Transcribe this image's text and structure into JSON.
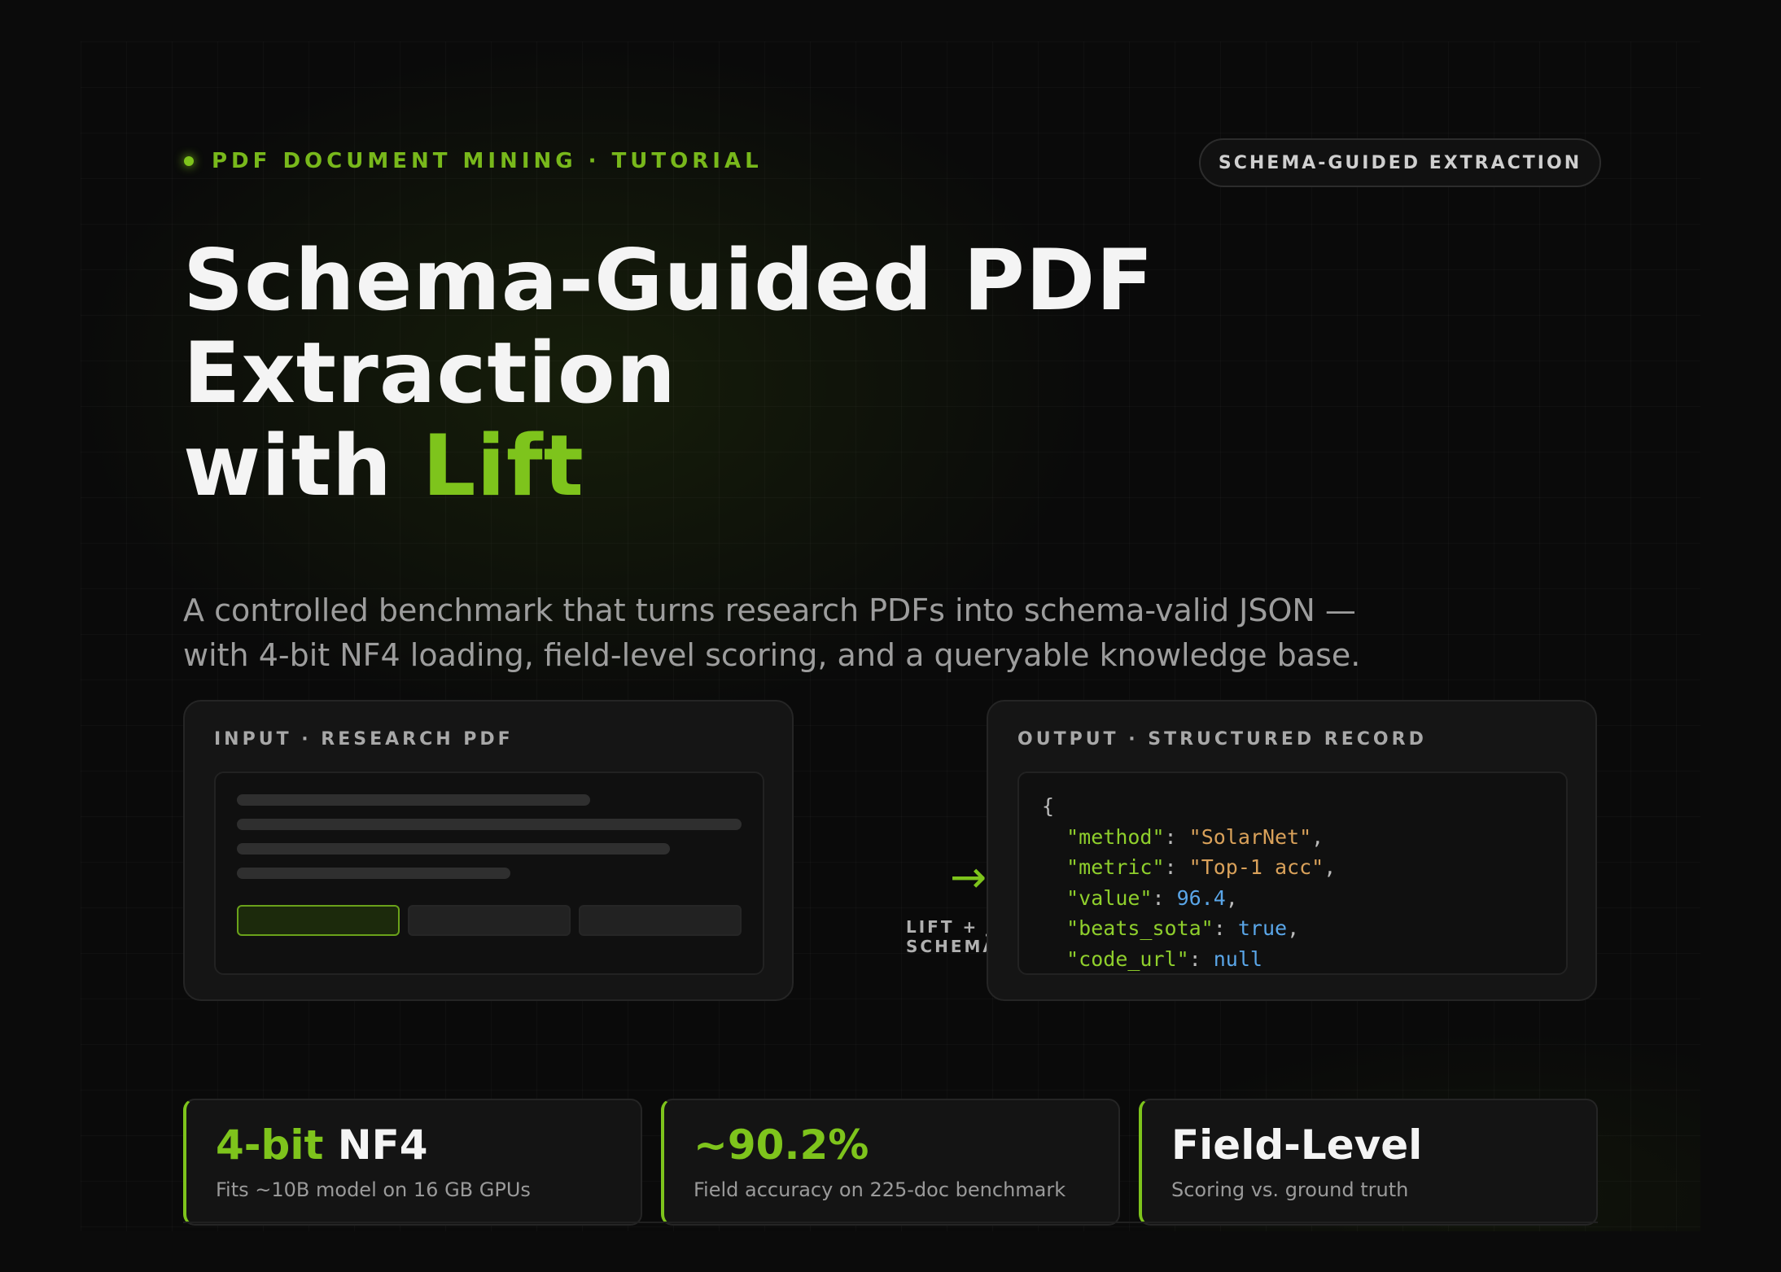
{
  "header": {
    "eyebrow": "PDF DOCUMENT MINING · TUTORIAL",
    "badge": "SCHEMA-GUIDED EXTRACTION"
  },
  "hero": {
    "title_line1": "Schema-Guided PDF",
    "title_line2": "Extraction",
    "title_line3_prefix": "with ",
    "title_line3_accent": "Lift",
    "subtitle_line1": "A controlled benchmark that turns research PDFs into schema-valid JSON —",
    "subtitle_line2": "with 4-bit NF4 loading, field-level scoring, and a queryable knowledge base."
  },
  "input_panel": {
    "label": "INPUT · RESEARCH PDF"
  },
  "flow": {
    "arrow_icon": "arrow-right-icon",
    "label_line1": "LIFT + JSON",
    "label_line2": "SCHEMA"
  },
  "output_panel": {
    "label": "OUTPUT · STRUCTURED RECORD",
    "open_brace": "{",
    "fields": [
      {
        "key": "\"method\"",
        "value": "\"SolarNet\"",
        "type": "string",
        "trail": ","
      },
      {
        "key": "\"metric\"",
        "value": "\"Top-1 acc\"",
        "type": "string",
        "trail": ","
      },
      {
        "key": "\"value\"",
        "value": "96.4",
        "type": "number",
        "trail": ","
      },
      {
        "key": "\"beats_sota\"",
        "value": "true",
        "type": "number",
        "trail": ","
      },
      {
        "key": "\"code_url\"",
        "value": "null",
        "type": "number",
        "trail": ""
      }
    ]
  },
  "stats": [
    {
      "accent": "4-bit",
      "rest": " NF4",
      "caption": "Fits ~10B model on 16 GB GPUs"
    },
    {
      "accent": "~90.2%",
      "rest": "",
      "caption": "Field accuracy on 225-doc benchmark"
    },
    {
      "accent": "",
      "rest": "Field-Level",
      "caption": "Scoring vs. ground truth"
    }
  ],
  "colors": {
    "accent": "#7ec41c",
    "background": "#0a0a0a",
    "string": "#d9a15a",
    "literal": "#5aa6e8"
  }
}
